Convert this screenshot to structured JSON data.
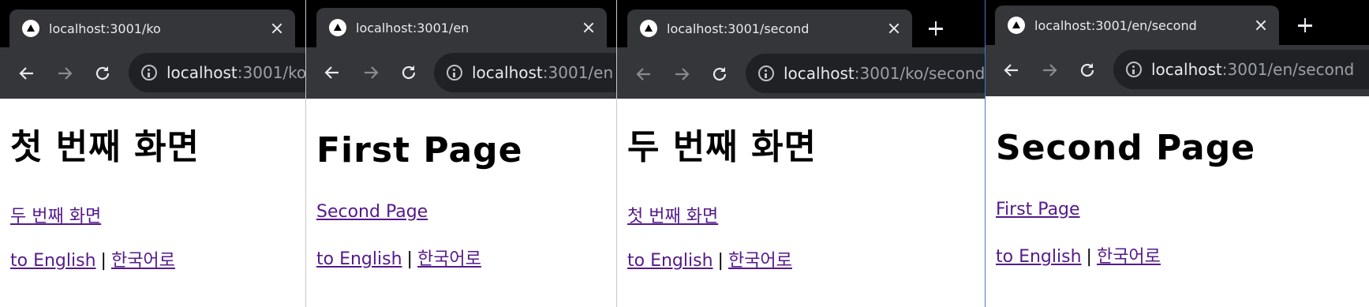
{
  "windows": [
    {
      "tab_title": "localhost:3001/ko",
      "url_host": "localhost",
      "url_path": ":3001/ko",
      "heading": "첫 번째 화면",
      "page_link": "두 번째 화면",
      "lang_en": "to English",
      "separator": "|",
      "lang_ko": "한국어로",
      "show_new_tab": false
    },
    {
      "tab_title": "localhost:3001/en",
      "url_host": "localhost",
      "url_path": ":3001/en",
      "heading": "First Page",
      "page_link": "Second Page",
      "lang_en": "to English",
      "separator": "|",
      "lang_ko": "한국어로",
      "show_new_tab": false
    },
    {
      "tab_title": "localhost:3001/second",
      "url_host": "localhost",
      "url_path": ":3001/ko/second",
      "heading": "두 번째 화면",
      "page_link": "첫 번째 화면",
      "lang_en": "to English",
      "separator": "|",
      "lang_ko": "한국어로",
      "show_new_tab": true
    },
    {
      "tab_title": "localhost:3001/en/second",
      "url_host": "localhost",
      "url_path": ":3001/en/second",
      "heading": "Second Page",
      "page_link": "First Page",
      "lang_en": "to English",
      "separator": "|",
      "lang_ko": "한국어로",
      "show_new_tab": true
    }
  ],
  "icons": {
    "favicon": "triangle-logo-icon",
    "close": "close-icon",
    "new_tab": "plus-icon",
    "back": "arrow-left-icon",
    "forward": "arrow-right-icon",
    "reload": "reload-icon",
    "site_info": "info-icon"
  },
  "colors": {
    "titlebar": "#000000",
    "tab_and_toolbar": "#35363a",
    "omnibox": "#202124",
    "link_visited": "#551a8b",
    "url_host": "#e8eaed",
    "url_path": "#9aa0a6"
  }
}
